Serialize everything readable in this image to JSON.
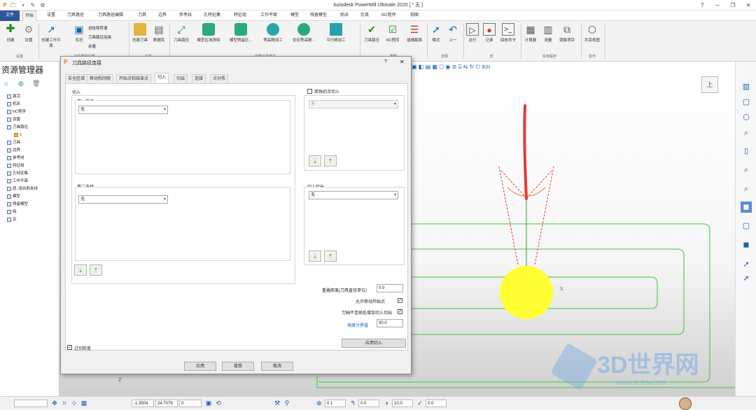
{
  "app": {
    "title": "Autodesk PowerMill Ultimate 2020   [ * 无 ]"
  },
  "menu": [
    "文件",
    "开始",
    "设置",
    "刀具路径",
    "刀具路径编辑",
    "刀具",
    "边界",
    "参考线",
    "孔特征集",
    "特征组",
    "工作平面",
    "模型",
    "残留模型",
    "机床",
    "仿真",
    "NC程序",
    "视图"
  ],
  "ribbon": {
    "buttons": [
      "创建",
      "设置",
      "创建工作平面",
      "毛坯",
      "进给和转速",
      "刀具路径连接",
      "余量",
      "创建刀具",
      "数据库",
      "刀具路径",
      "模型区域清除",
      "模型残留区...",
      "等高精加工",
      "优化等高精...",
      "平行精加工",
      "刀具路径",
      "NC程序",
      "插播截面",
      "模式",
      "上一",
      "运行",
      "记录",
      "回放命令",
      "计算器",
      "测量",
      "镜像项目",
      "共享视图"
    ],
    "groups": [
      "设置",
      "刀具路径设置",
      "刀具",
      "创建刀具路径",
      "策略",
      "选择",
      "宏",
      "实用程序",
      "协作"
    ]
  },
  "explorer": {
    "title": "资源管理器",
    "items": [
      "激活",
      "机床",
      "NC程序",
      "设置",
      "刀具路径",
      "1",
      "刀具",
      "边界",
      "参考线",
      "特征组",
      "孔特征集",
      "工作平面",
      "层, 组合和夹持",
      "模型",
      "残留模型",
      "组",
      "宏"
    ]
  },
  "dialog": {
    "title": "刀具路径连接",
    "help": "?",
    "tabs": [
      "安全区域",
      "移动和间隙",
      "开始点和结束点",
      "切入",
      "切出",
      "连接",
      "点分布"
    ],
    "active_tab": "切入",
    "section_label": "切入",
    "first_choice_label": "第一选择",
    "first_choice_value": "无",
    "second_choice_label": "第二选择",
    "second_choice_value": "无",
    "first_only_label": "单独初次切入",
    "first_only_value": "无",
    "extension_label": "切入延长",
    "extension_value": "无",
    "overlap_label": "重叠距离(刀具直径单位)",
    "overlap_value": "0.0",
    "allow_start_label": "允许移动开始点",
    "discontinuous_label": "刀轴不连续处增加切入切出",
    "angle_label": "角度分界值",
    "angle_value": "90.0",
    "apply_in_button": "应用切入",
    "gouge_check_label": "过切检查",
    "apply_button": "应用",
    "accept_button": "接受",
    "cancel_button": "取消"
  },
  "viewport": {
    "axis_label": "X",
    "axis_z": "Z",
    "view_label": "上"
  },
  "viewtools": {
    "label": "系列"
  },
  "statusbar": {
    "x": "-1.3504",
    "y": "24.7079",
    "z": "0",
    "feed": "0.1",
    "a": "0.0",
    "b": "10.0",
    "c": "0.0"
  },
  "watermark": {
    "text": "3D世界网",
    "url": "WWW.3DSJW.COM"
  },
  "colors": {
    "accent": "#2b579a",
    "tool_red": "#e53935",
    "ball_yellow": "#ffff33",
    "path_green": "#39c739"
  }
}
